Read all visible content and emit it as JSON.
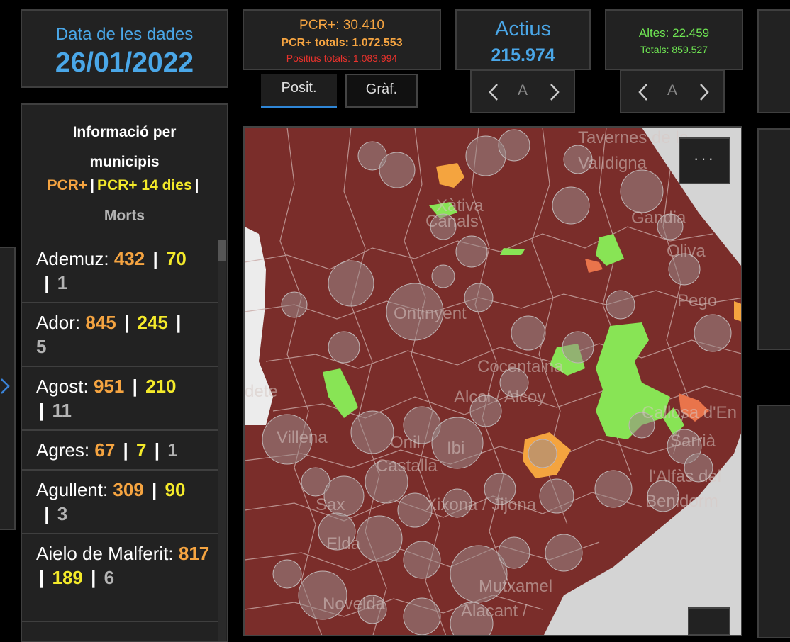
{
  "date": {
    "label": "Data de les dades",
    "value": "26/01/2022"
  },
  "pcr": {
    "line1": "PCR+: 30.410",
    "line2": "PCR+ totals: 1.072.553",
    "line3": "Positius totals: 1.083.994",
    "tabs": [
      "Posit.",
      "Gràf."
    ]
  },
  "actius": {
    "label": "Actius",
    "value": "215.974",
    "nav_mid": "A"
  },
  "altes": {
    "line1": "Altes: 22.459",
    "line2": "Totals: 859.527",
    "nav_mid": "A"
  },
  "municipis": {
    "title_line1": "Informació per",
    "title_line2": "municipis",
    "legend_pcr": "PCR+",
    "legend_pcr14": "PCR+ 14 dies",
    "legend_morts": "Morts",
    "items": [
      {
        "name": "Ademuz",
        "pcr": "432",
        "pcr14": "70",
        "morts": "1"
      },
      {
        "name": "Ador",
        "pcr": "845",
        "pcr14": "245",
        "morts": "5"
      },
      {
        "name": "Agost",
        "pcr": "951",
        "pcr14": "210",
        "morts": "11"
      },
      {
        "name": "Agres",
        "pcr": "67",
        "pcr14": "7",
        "morts": "1"
      },
      {
        "name": "Agullent",
        "pcr": "309",
        "pcr14": "90",
        "morts": "3"
      },
      {
        "name": "Aielo de Malferit",
        "pcr": "817",
        "pcr14": "189",
        "morts": "6"
      }
    ]
  },
  "map": {
    "menu_label": "···",
    "cities": [
      "Tavernes de la Valldigna",
      "Xàtiva",
      "Canals",
      "Gandia",
      "Oliva",
      "Ontinyent",
      "Pego",
      "Cocentaina",
      "Alcoi / Alcoy",
      "Callosa d'En",
      "Villena",
      "Onil",
      "Ibi",
      "Castalla",
      "Sax",
      "Xixona / Jijona",
      "l'Alfàs del",
      "Benidorm",
      "Elda",
      "Mutxamel",
      "Novelda",
      "Alacant /",
      "Sarrià",
      "dete"
    ],
    "colors": {
      "dark": "#7a2d2a",
      "green": "#88e455",
      "orange": "#f4a43f",
      "coral": "#e9744b",
      "bubble": "#9a8888",
      "sea": "#d4d4d4"
    }
  }
}
